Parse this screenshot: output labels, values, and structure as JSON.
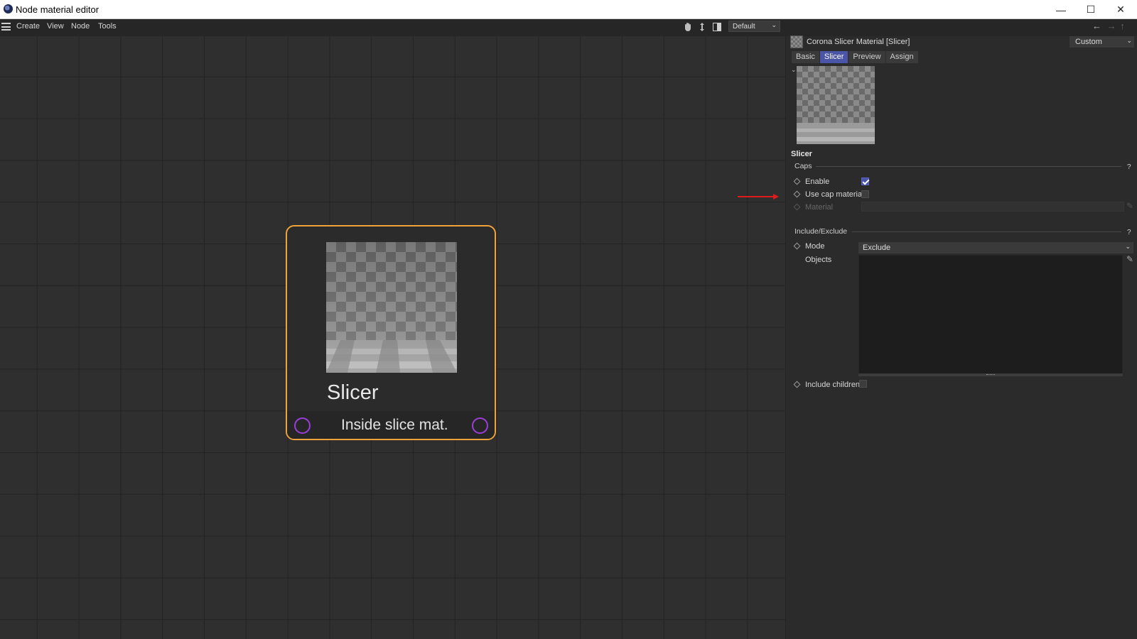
{
  "window": {
    "title": "Node material editor",
    "controls": {
      "minimize": "—",
      "maximize": "☐",
      "close": "✕"
    }
  },
  "menubar": {
    "items": [
      "Create",
      "View",
      "Node",
      "Tools"
    ],
    "layout_selector": "Default"
  },
  "node": {
    "title": "Slicer",
    "port_label": "Inside slice mat.",
    "border_color": "#f0a23a",
    "port_color": "#9a3ed6"
  },
  "panel": {
    "material_name": "Corona Slicer Material [Slicer]",
    "preset": "Custom",
    "tabs": [
      {
        "label": "Basic",
        "active": false
      },
      {
        "label": "Slicer",
        "active": true
      },
      {
        "label": "Preview",
        "active": false
      },
      {
        "label": "Assign",
        "active": false
      }
    ],
    "section_title": "Slicer",
    "caps": {
      "label": "Caps",
      "help": "?",
      "enable": {
        "label": "Enable",
        "checked": true
      },
      "use_cap_material": {
        "label": "Use cap material",
        "checked": false
      },
      "material": {
        "label": "Material",
        "enabled": false
      }
    },
    "include_exclude": {
      "label": "Include/Exclude",
      "help": "?",
      "mode": {
        "label": "Mode",
        "value": "Exclude"
      },
      "objects": {
        "label": "Objects"
      },
      "include_children": {
        "label": "Include children",
        "checked": false
      }
    }
  },
  "colors": {
    "accent": "#4a55a8",
    "annotation_arrow": "#e01b1b"
  }
}
